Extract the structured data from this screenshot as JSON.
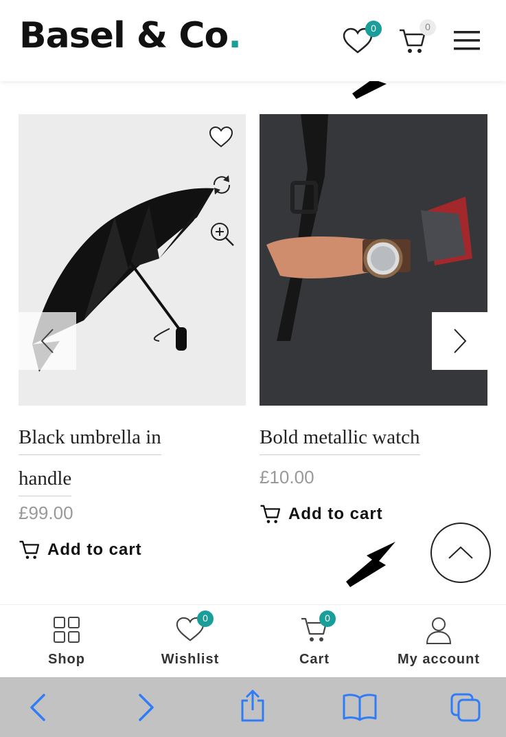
{
  "header": {
    "logo_text": "Basel & Co",
    "logo_dot": ".",
    "wishlist_count": "0",
    "cart_count": "0",
    "icons": [
      "heart-icon",
      "cart-icon",
      "hamburger-menu-icon"
    ]
  },
  "products": [
    {
      "title_line1": "Black umbrella in",
      "title_line2": "handle",
      "price": "£99.00",
      "add_to_cart": "Add to cart"
    },
    {
      "title_line1": "Bold metallic watch",
      "price": "£10.00",
      "add_to_cart": "Add to cart"
    }
  ],
  "tabbar": {
    "items": [
      {
        "label": "Shop",
        "icon": "grid-icon"
      },
      {
        "label": "Wishlist",
        "icon": "heart-icon",
        "count": "0"
      },
      {
        "label": "Cart",
        "icon": "cart-icon",
        "count": "0"
      },
      {
        "label": "My account",
        "icon": "user-icon"
      }
    ]
  },
  "colors": {
    "accent": "#1a9e9a",
    "browser_bar": "#c2c2c2",
    "browser_icon": "#2f7cf6"
  }
}
